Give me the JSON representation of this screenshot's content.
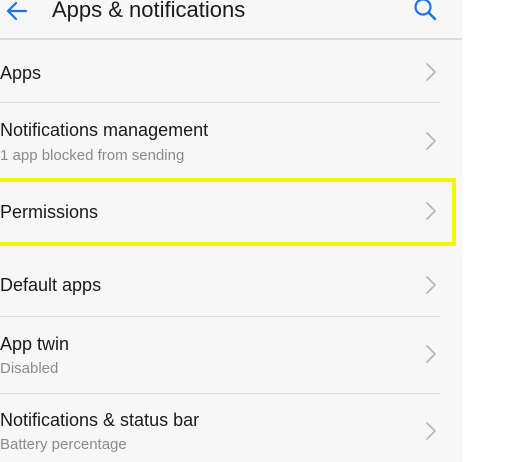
{
  "header": {
    "title": "Apps & notifications",
    "back_icon": "arrow-left-icon",
    "search_icon": "search-icon",
    "accent_color": "#1a73e8"
  },
  "menu": [
    {
      "title": "Apps"
    },
    {
      "title": "Notifications management",
      "subtitle": "1 app blocked from sending"
    },
    {
      "title": "Permissions",
      "highlighted": true,
      "highlight_color": "#f5f500"
    },
    {
      "title": "Default apps"
    },
    {
      "title": "App twin",
      "subtitle": "Disabled"
    },
    {
      "title": "Notifications & status bar",
      "subtitle": "Battery percentage"
    }
  ],
  "chevron_icon": "chevron-right-icon"
}
